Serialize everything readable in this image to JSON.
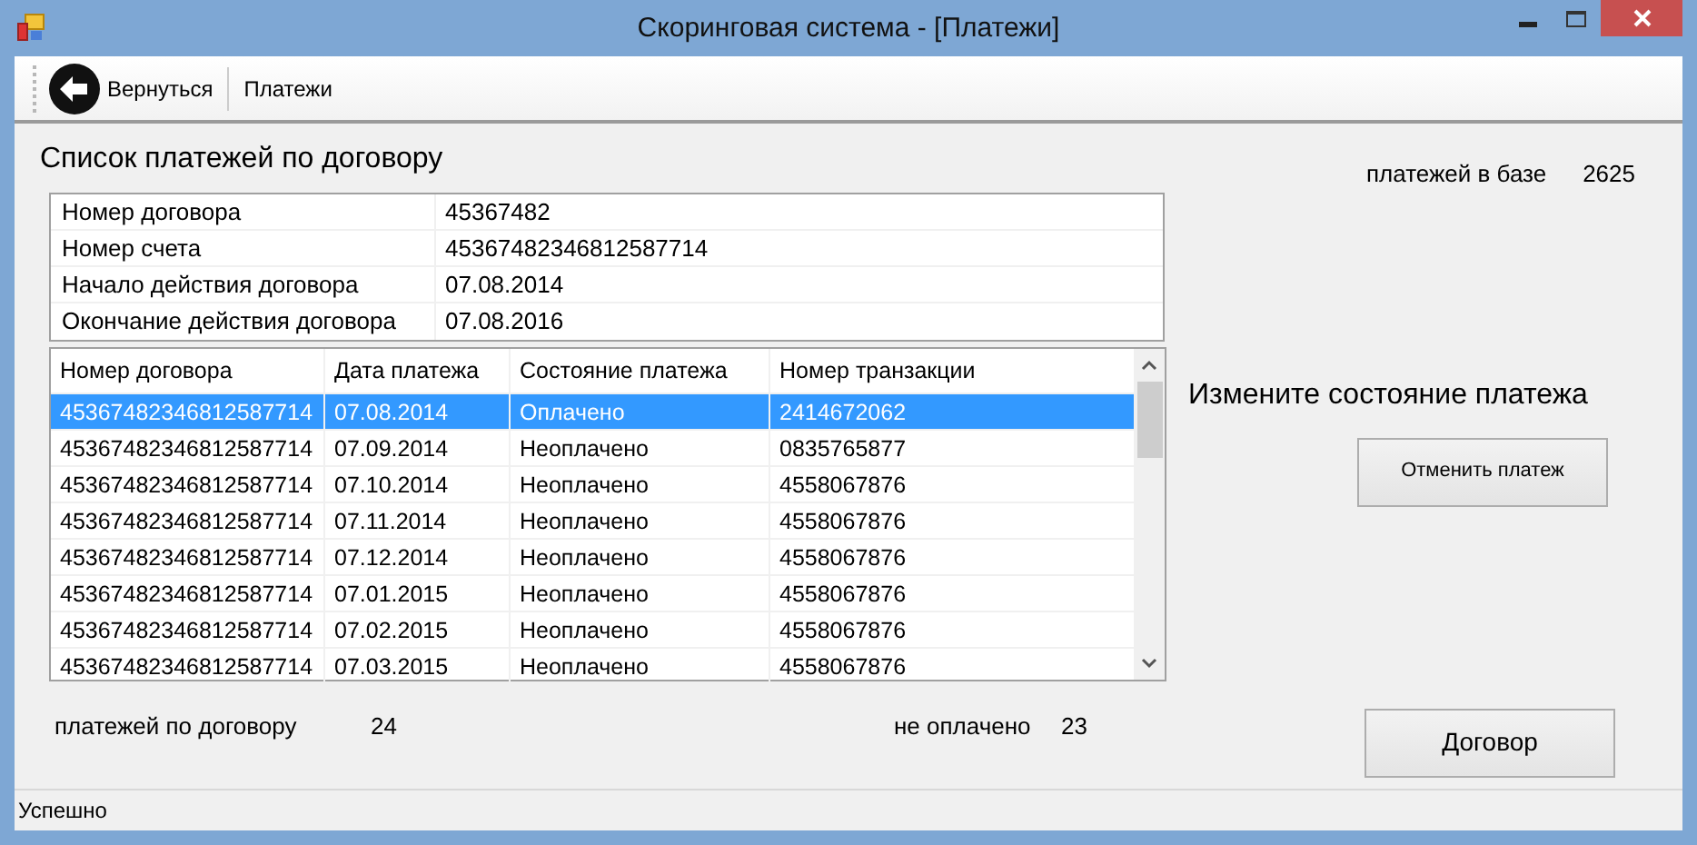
{
  "window": {
    "title": "Скоринговая система - [Платежи]"
  },
  "toolbar": {
    "back_button": "Вернуться",
    "label": "Платежи"
  },
  "heading": "Список платежей по договору",
  "db_count": {
    "label": "платежей в базе",
    "value": "2625"
  },
  "contract_info": [
    {
      "label": "Номер договора",
      "value": "45367482"
    },
    {
      "label": "Номер счета",
      "value": "45367482346812587714"
    },
    {
      "label": "Начало действия договора",
      "value": "07.08.2014"
    },
    {
      "label": "Окончание действия договора",
      "value": "07.08.2016"
    }
  ],
  "payments": {
    "columns": [
      "Номер договора",
      "Дата платежа",
      "Состояние платежа",
      "Номер транзакции"
    ],
    "rows": [
      {
        "cells": [
          "45367482346812587714",
          "07.08.2014",
          "Оплачено",
          "2414672062"
        ],
        "selected": true
      },
      {
        "cells": [
          "45367482346812587714",
          "07.09.2014",
          "Неоплачено",
          "0835765877"
        ],
        "selected": false
      },
      {
        "cells": [
          "45367482346812587714",
          "07.10.2014",
          "Неоплачено",
          "4558067876"
        ],
        "selected": false
      },
      {
        "cells": [
          "45367482346812587714",
          "07.11.2014",
          "Неоплачено",
          "4558067876"
        ],
        "selected": false
      },
      {
        "cells": [
          "45367482346812587714",
          "07.12.2014",
          "Неоплачено",
          "4558067876"
        ],
        "selected": false
      },
      {
        "cells": [
          "45367482346812587714",
          "07.01.2015",
          "Неоплачено",
          "4558067876"
        ],
        "selected": false
      },
      {
        "cells": [
          "45367482346812587714",
          "07.02.2015",
          "Неоплачено",
          "4558067876"
        ],
        "selected": false
      },
      {
        "cells": [
          "45367482346812587714",
          "07.03.2015",
          "Неоплачено",
          "4558067876"
        ],
        "selected": false
      }
    ]
  },
  "summary": {
    "payments_label": "платежей по договору",
    "payments_value": "24",
    "unpaid_label": "не оплачено",
    "unpaid_value": "23"
  },
  "side": {
    "heading": "Измените состояние платежа",
    "cancel_button": "Отменить платеж",
    "contract_button": "Договор"
  },
  "status_bar": "Успешно"
}
